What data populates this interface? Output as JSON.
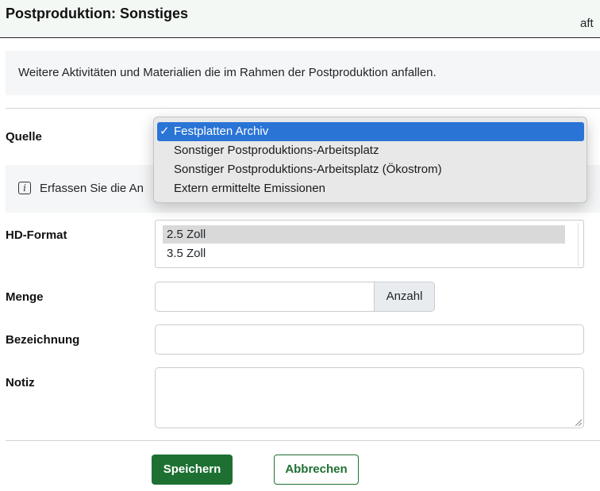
{
  "header": {
    "title": "Postproduktion: Sonstiges"
  },
  "description": "Weitere Aktivitäten und Materialien die im Rahmen der Postproduktion anfallen.",
  "info": {
    "text_visible": "Erfassen Sie die An",
    "text_tail": "aft"
  },
  "fields": {
    "quelle": {
      "label": "Quelle"
    },
    "hd_format": {
      "label": "HD-Format",
      "options": [
        "2.5 Zoll",
        "3.5 Zoll"
      ],
      "selected": "2.5 Zoll"
    },
    "menge": {
      "label": "Menge",
      "value": "",
      "addon": "Anzahl"
    },
    "bezeichnung": {
      "label": "Bezeichnung",
      "value": ""
    },
    "notiz": {
      "label": "Notiz",
      "value": ""
    }
  },
  "dropdown": {
    "check": "✓",
    "options": [
      "Festplatten Archiv",
      "Sonstiger Postproduktions-Arbeitsplatz",
      "Sonstiger Postproduktions-Arbeitsplatz (Ökostrom)",
      "Extern ermittelte Emissionen"
    ],
    "selected": "Festplatten Archiv"
  },
  "buttons": {
    "save": "Speichern",
    "cancel": "Abbrechen"
  },
  "colors": {
    "primary": "#1e7032",
    "highlight": "#2a74d6",
    "header_bg": "#f3f8f4"
  },
  "icons": {
    "info": "info-icon",
    "resize": "resize-grip-icon"
  }
}
